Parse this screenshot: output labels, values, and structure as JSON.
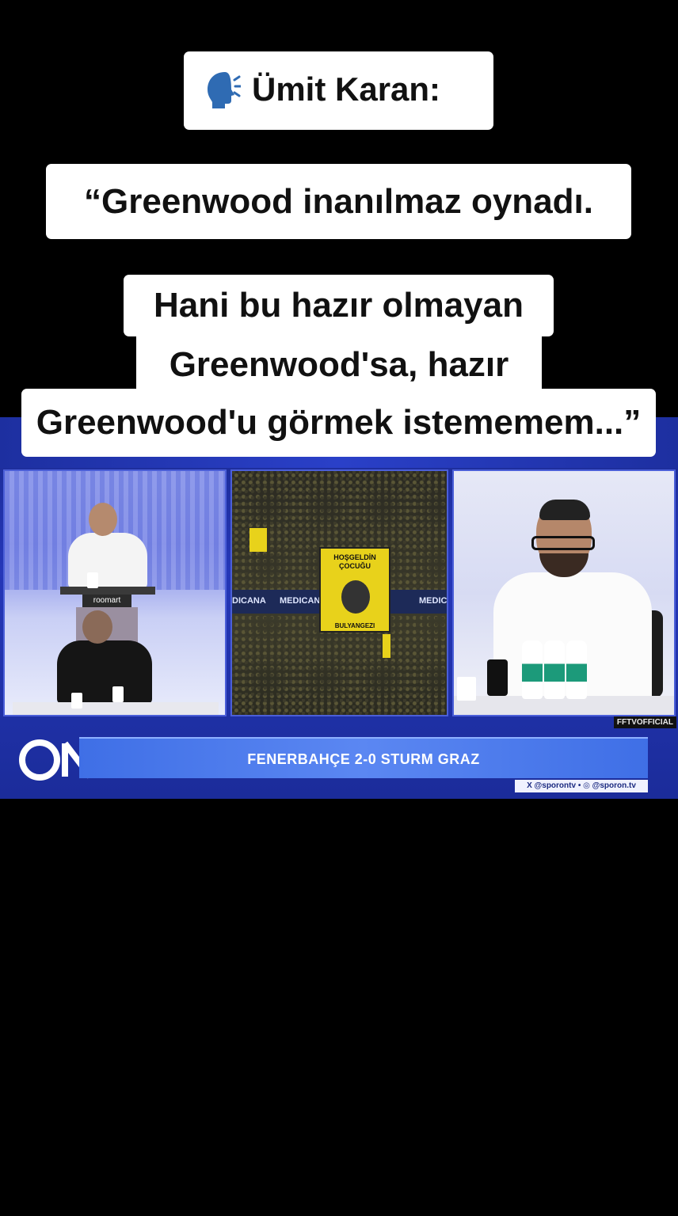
{
  "captions": {
    "speaker": "Ümit Karan:",
    "speaker_icon": "speaking-head-icon",
    "line1": "“Greenwood inanılmaz oynadı.",
    "line2": "Hani bu hazır olmayan",
    "line3": "Greenwood'sa, hazır",
    "line4": "Greenwood'u görmek istememem...”"
  },
  "video": {
    "studio_sign": "roomart",
    "stadium_board_left": "DICANA",
    "stadium_board_mid": "MEDICANA",
    "stadium_board_right": "MEDIC",
    "banner_text": "HOŞGELDİN ÇOCUĞU",
    "banner_bottom": "BULYANGEZI",
    "watermark": "FFTVOFFICIAL",
    "score_bar_title": "FENERBAHÇE 2-0 STURM GRAZ",
    "social_handles": "X @sporontv  •  ◎ @sporon.tv",
    "logo_text": "ON",
    "colors": {
      "bar": "#4a79ec",
      "video_bg": "#2537b8",
      "caption_bg": "#ffffff",
      "banner": "#e8d21b"
    }
  }
}
